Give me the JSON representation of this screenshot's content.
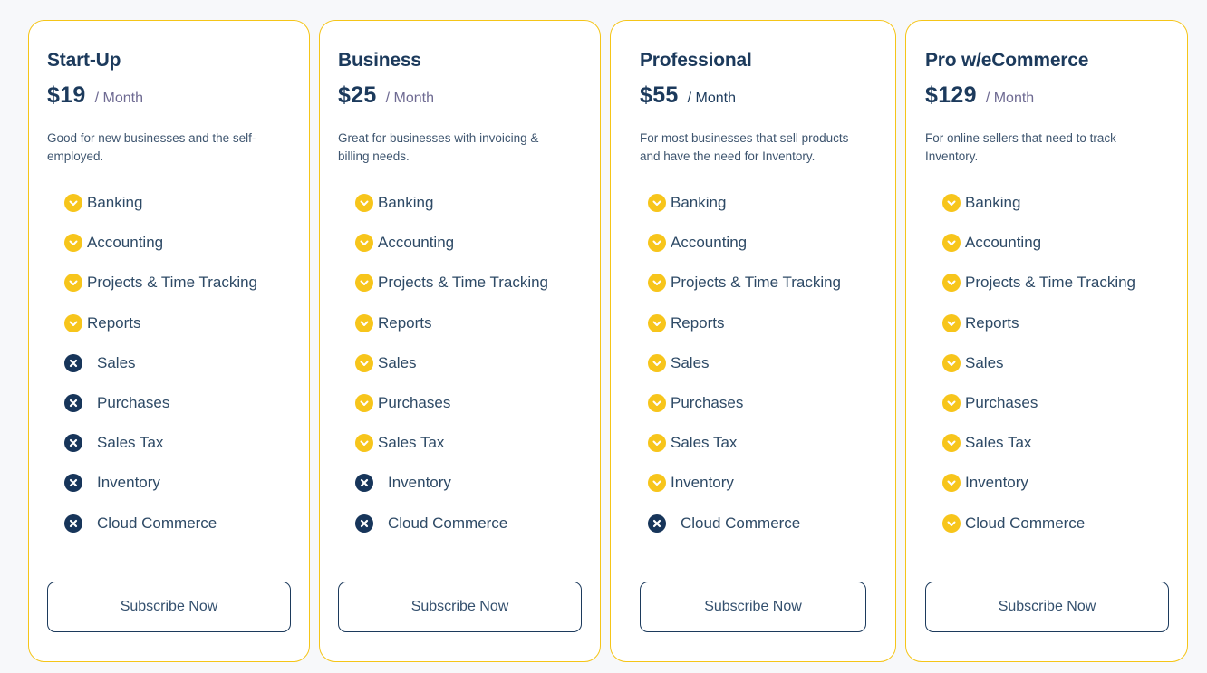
{
  "colors": {
    "accent_yellow": "#f5c518",
    "navy": "#1c3a5c",
    "background": "#f7f8fa"
  },
  "plans": [
    {
      "name": "Start-Up",
      "price": "$19",
      "period": "/ Month",
      "description": "Good for new businesses and the self-employed.",
      "button_label": "Subscribe Now",
      "features": [
        {
          "label": "Banking",
          "included": true,
          "icon": "check-circle-icon"
        },
        {
          "label": "Accounting",
          "included": true,
          "icon": "check-circle-icon"
        },
        {
          "label": "Projects & Time Tracking",
          "included": true,
          "icon": "check-circle-icon"
        },
        {
          "label": "Reports",
          "included": true,
          "icon": "check-circle-icon"
        },
        {
          "label": "Sales",
          "included": false,
          "icon": "x-circle-icon"
        },
        {
          "label": "Purchases",
          "included": false,
          "icon": "x-circle-icon"
        },
        {
          "label": "Sales Tax",
          "included": false,
          "icon": "x-circle-icon"
        },
        {
          "label": "Inventory",
          "included": false,
          "icon": "x-circle-icon"
        },
        {
          "label": "Cloud Commerce",
          "included": false,
          "icon": "x-circle-icon"
        }
      ]
    },
    {
      "name": "Business",
      "price": "$25",
      "period": "/ Month",
      "description": "Great for businesses with invoicing & billing needs.",
      "button_label": "Subscribe Now",
      "features": [
        {
          "label": "Banking",
          "included": true,
          "icon": "check-circle-icon"
        },
        {
          "label": "Accounting",
          "included": true,
          "icon": "check-circle-icon"
        },
        {
          "label": "Projects & Time Tracking",
          "included": true,
          "icon": "check-circle-icon"
        },
        {
          "label": "Reports",
          "included": true,
          "icon": "check-circle-icon"
        },
        {
          "label": "Sales",
          "included": true,
          "icon": "check-circle-icon"
        },
        {
          "label": "Purchases",
          "included": true,
          "icon": "check-circle-icon"
        },
        {
          "label": "Sales Tax",
          "included": true,
          "icon": "check-circle-icon"
        },
        {
          "label": "Inventory",
          "included": false,
          "icon": "x-circle-icon"
        },
        {
          "label": "Cloud Commerce",
          "included": false,
          "icon": "x-circle-icon"
        }
      ]
    },
    {
      "name": "Professional",
      "price": "$55",
      "period": "/ Month",
      "description": "For most businesses that sell products and have the need for Inventory.",
      "button_label": "Subscribe Now",
      "features": [
        {
          "label": "Banking",
          "included": true,
          "icon": "check-circle-icon"
        },
        {
          "label": "Accounting",
          "included": true,
          "icon": "check-circle-icon"
        },
        {
          "label": "Projects & Time Tracking",
          "included": true,
          "icon": "check-circle-icon"
        },
        {
          "label": "Reports",
          "included": true,
          "icon": "check-circle-icon"
        },
        {
          "label": "Sales",
          "included": true,
          "icon": "check-circle-icon"
        },
        {
          "label": "Purchases",
          "included": true,
          "icon": "check-circle-icon"
        },
        {
          "label": "Sales Tax",
          "included": true,
          "icon": "check-circle-icon"
        },
        {
          "label": "Inventory",
          "included": true,
          "icon": "check-circle-icon"
        },
        {
          "label": "Cloud Commerce",
          "included": false,
          "icon": "x-circle-icon"
        }
      ]
    },
    {
      "name": "Pro w/eCommerce",
      "price": "$129",
      "period": "/ Month",
      "description": "For online sellers that need to track Inventory.",
      "button_label": "Subscribe Now",
      "features": [
        {
          "label": "Banking",
          "included": true,
          "icon": "check-circle-icon"
        },
        {
          "label": "Accounting",
          "included": true,
          "icon": "check-circle-icon"
        },
        {
          "label": "Projects & Time Tracking",
          "included": true,
          "icon": "check-circle-icon"
        },
        {
          "label": "Reports",
          "included": true,
          "icon": "check-circle-icon"
        },
        {
          "label": "Sales",
          "included": true,
          "icon": "check-circle-icon"
        },
        {
          "label": "Purchases",
          "included": true,
          "icon": "check-circle-icon"
        },
        {
          "label": "Sales Tax",
          "included": true,
          "icon": "check-circle-icon"
        },
        {
          "label": "Inventory",
          "included": true,
          "icon": "check-circle-icon"
        },
        {
          "label": "Cloud Commerce",
          "included": true,
          "icon": "check-circle-icon"
        }
      ]
    }
  ]
}
